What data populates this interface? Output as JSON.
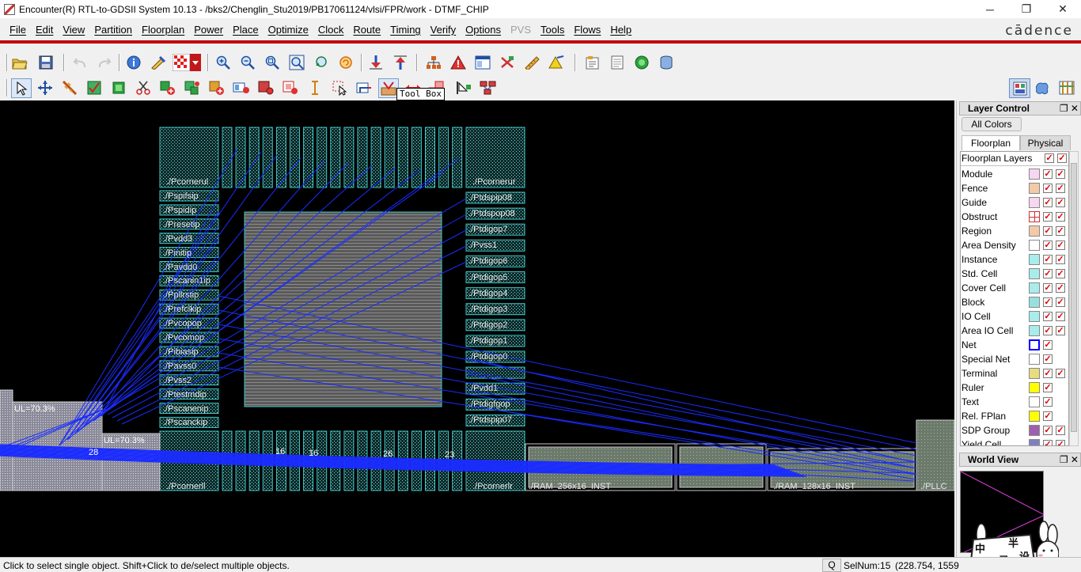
{
  "window": {
    "title": "Encounter(R) RTL-to-GDSII System 10.13 - /bks2/Chenglin_Stu2019/PB17061124/vlsi/FPR/work - DTMF_CHIP",
    "minimize": "─",
    "maximize": "❐",
    "close": "✕"
  },
  "menu": {
    "items": [
      "File",
      "Edit",
      "View",
      "Partition",
      "Floorplan",
      "Power",
      "Place",
      "Optimize",
      "Clock",
      "Route",
      "Timing",
      "Verify",
      "Options",
      "PVS",
      "Tools",
      "Flows",
      "Help"
    ],
    "disabled": [
      "PVS"
    ],
    "brand": "cādence"
  },
  "tooltip": "Tool Box",
  "canvas": {
    "left_pads": [
      "./Pspifsip",
      "./Pspidip",
      "./Presetip",
      "./Pvdd3",
      "./Pinitip",
      "./Pavdd0",
      "./Pscanin1ip",
      "./Ppllrstip",
      "./Prefclkip",
      "./Pvcopop",
      "./Pvcomop",
      "./Pibiasip",
      "./Pavss0",
      "./Pvss2",
      "./Ptestmdip",
      "./Pscanenip",
      "./Pscanckip"
    ],
    "right_pads": [
      "./Ptdspip08",
      "./Ptdspop08",
      "./Ptdigop7",
      "./Pvss1",
      "./Ptdigop6",
      "./Ptdigop5",
      "./Ptdigop4",
      "./Ptdigop3",
      "./Ptdigop2",
      "./Ptdigop1",
      "./Ptdigop0",
      "",
      "./Pvdd1",
      "./Ptdigfgop",
      "./Ptdspip07"
    ],
    "corners": {
      "ul": "./Pcornerul",
      "ur": "./Pcornerur",
      "ll": "./Pcornerll",
      "lr": "./Pcornerlr"
    },
    "block_labels": {
      "ram256": "./RAM_256x16_INST",
      "ram128": "./RAM_128x16_INST",
      "pllc": "./PLLC"
    },
    "util_labels": [
      "UL=70.3%",
      "UL=70.3%"
    ],
    "net_counts": [
      "28",
      "16",
      "16",
      "26",
      "23"
    ]
  },
  "layer_control": {
    "title": "Layer Control",
    "all_colors": "All Colors",
    "tabs": [
      "Floorplan",
      "Physical"
    ],
    "active_tab": "Floorplan",
    "header": "Floorplan Layers",
    "layers": [
      {
        "name": "Module",
        "color": "#f6d6f0",
        "checks": 2
      },
      {
        "name": "Fence",
        "color": "#f3c9a8",
        "checks": 2
      },
      {
        "name": "Guide",
        "color": "#f6d6f0",
        "checks": 2
      },
      {
        "name": "Obstruct",
        "color": "#ffffff",
        "checks": 2
      },
      {
        "name": "Region",
        "color": "#f3c9a8",
        "checks": 2
      },
      {
        "name": "Area Density",
        "color": "#ffffff",
        "checks": 2
      },
      {
        "name": "Instance",
        "color": "#a8ecec",
        "checks": 2
      },
      {
        "name": "Std. Cell",
        "color": "#a8ecec",
        "checks": 2
      },
      {
        "name": "Cover Cell",
        "color": "#a8ecec",
        "checks": 2
      },
      {
        "name": "Block",
        "color": "#98e0e0",
        "checks": 2
      },
      {
        "name": "IO Cell",
        "color": "#a8ecec",
        "checks": 2
      },
      {
        "name": "Area IO Cell",
        "color": "#a8ecec",
        "checks": 2
      },
      {
        "name": "Net",
        "color": "#0000ff",
        "checks": 1
      },
      {
        "name": "Special Net",
        "color": "#ffffff",
        "checks": 1
      },
      {
        "name": "Terminal",
        "color": "#e8dc80",
        "checks": 2
      },
      {
        "name": "Ruler",
        "color": "#ffff00",
        "checks": 1
      },
      {
        "name": "Text",
        "color": "#ffffff",
        "checks": 1
      },
      {
        "name": "Rel. FPlan",
        "color": "#ffff00",
        "checks": 1
      },
      {
        "name": "SDP Group",
        "color": "#a060b0",
        "checks": 2
      },
      {
        "name": "Yield Cell",
        "color": "#8080c0",
        "checks": 2
      }
    ]
  },
  "world_view": {
    "title": "World View"
  },
  "mascot_text": [
    "中",
    "半",
    "腰",
    "录",
    "设"
  ],
  "status": {
    "message": "Click to select single object. Shift+Click to de/select multiple objects.",
    "q": "Q",
    "selnum": "SelNum:15",
    "coord": "(228.754, 1559"
  }
}
